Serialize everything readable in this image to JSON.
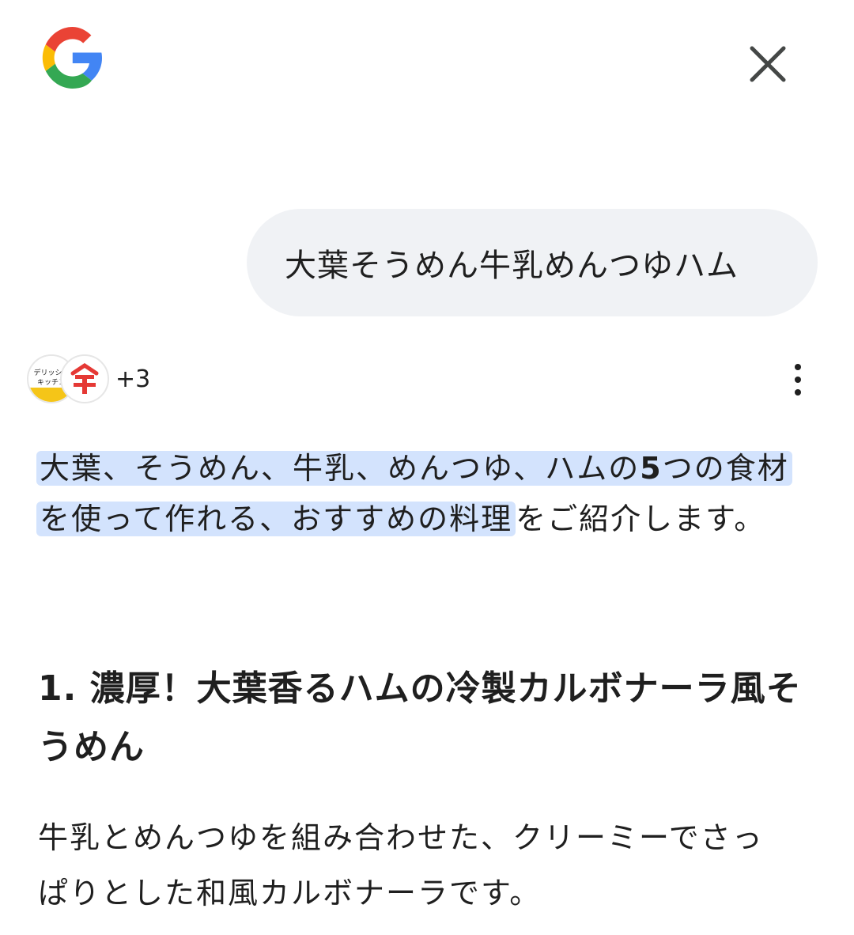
{
  "header": {
    "logo_icon": "google-g-logo",
    "close_icon": "close-icon"
  },
  "query": {
    "text": "大葉そうめん牛乳めんつゆハム"
  },
  "sources": {
    "source1_lines": [
      "デリッシュ",
      "キッチン"
    ],
    "source2_icon": "red-logo-icon",
    "count_label": "+3",
    "more_icon": "more-vert-icon"
  },
  "answer": {
    "highlight_pre": "大葉、そうめん、牛乳、めんつゆ、ハムの",
    "highlight_num": "5",
    "highlight_post": "つの食材を使って作れる、おすすめの料理",
    "rest": "をご紹介します。"
  },
  "section1": {
    "heading": "1. 濃厚！大葉香るハムの冷製カルボナーラ風そうめん",
    "body": "牛乳とめんつゆを組み合わせた、クリーミーでさっぱりとした和風カルボナーラです。"
  },
  "colors": {
    "highlight": "#d3e3fd",
    "bubble": "#f0f2f5",
    "text": "#1f1f1f",
    "google_blue": "#4285F4",
    "google_red": "#EA4335",
    "google_yellow": "#FBBC05",
    "google_green": "#34A853"
  }
}
